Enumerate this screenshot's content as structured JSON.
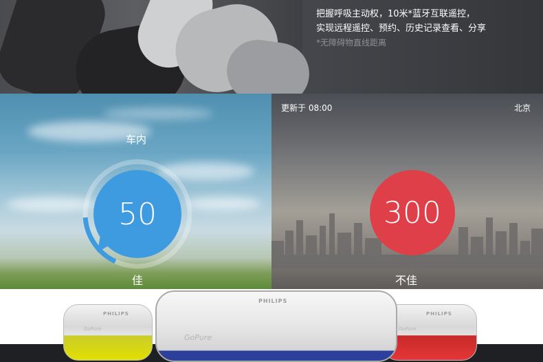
{
  "banner": {
    "line1": "把握呼吸主动权，10米*蓝牙互联遥控，",
    "line2": "实现远程遥控、预约、历史记录查看、分享",
    "note": "*无障碍物直线距离"
  },
  "indoor": {
    "label": "车内",
    "value": "50",
    "status": "佳",
    "color": "#3f9be0",
    "gauge_fraction": 0.17
  },
  "outdoor": {
    "updated": "更新于 08:00",
    "city": "北京",
    "value": "300",
    "status": "不佳",
    "color": "#de3f49"
  },
  "products": {
    "brand": "PHILIPS",
    "model": "GoPure",
    "colors": [
      "#e2e000",
      "#2c3f9a",
      "#e43636"
    ]
  }
}
